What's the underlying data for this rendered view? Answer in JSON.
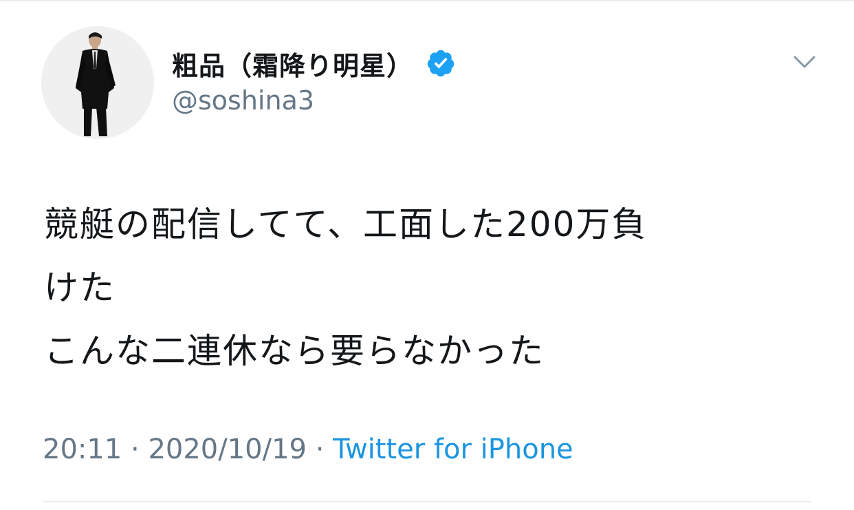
{
  "tweet": {
    "author": {
      "display_name": "粗品（霜降り明星）",
      "handle": "@soshina3",
      "verified": true
    },
    "text_lines": [
      "競艇の配信してて、工面した200万負",
      "けた",
      "こんな二連休なら要らなかった"
    ],
    "time": "20:11",
    "separator": "·",
    "date": "2020/10/19",
    "source": "Twitter for iPhone"
  },
  "icons": {
    "verified": "verified-badge-icon",
    "menu": "chevron-down-icon"
  },
  "colors": {
    "verified_blue": "#1da1f2",
    "source_link": "#1b95e0",
    "secondary_text": "#657786",
    "primary_text": "#14171a"
  }
}
